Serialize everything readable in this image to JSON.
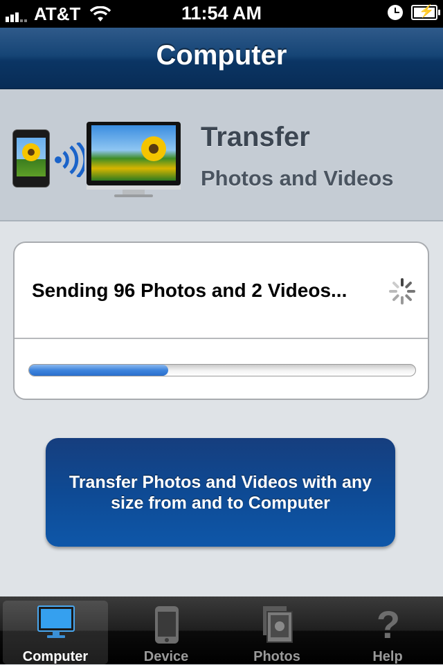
{
  "status_bar": {
    "carrier": "AT&T",
    "time": "11:54 AM"
  },
  "nav": {
    "title": "Computer"
  },
  "header": {
    "title": "Transfer",
    "subtitle": "Photos and Videos"
  },
  "progress": {
    "message": "Sending 96 Photos and 2 Videos...",
    "fraction": 0.36
  },
  "cta": {
    "label": "Transfer Photos and Videos with any size from and to Computer"
  },
  "tabs": [
    {
      "label": "Computer",
      "icon": "monitor-icon",
      "active": true
    },
    {
      "label": "Device",
      "icon": "phone-icon",
      "active": false
    },
    {
      "label": "Photos",
      "icon": "photos-icon",
      "active": false
    },
    {
      "label": "Help",
      "icon": "help-icon",
      "active": false
    }
  ],
  "colors": {
    "nav_blue": "#0b3564",
    "progress_blue": "#3e84dd",
    "cta_blue": "#0e4a94"
  }
}
